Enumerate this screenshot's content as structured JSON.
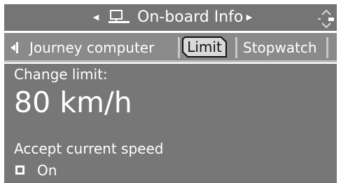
{
  "header": {
    "title": "On-board Info",
    "icons": {
      "left": "arrow-left-small-icon",
      "computer": "computer-icon",
      "right": "arrow-right-small-icon",
      "updown": "up-down-selector-icon"
    }
  },
  "tabs": {
    "back_icon": "back-arrow-icon",
    "journey_computer": "Journey computer",
    "limit": "Limit",
    "stopwatch": "Stopwatch",
    "selected": "Limit"
  },
  "content": {
    "change_limit_label": "Change limit:",
    "limit_value": "80 km/h",
    "accept_current_speed": "Accept current speed",
    "option_label": "On"
  },
  "colors": {
    "header_bg": "#757575",
    "tabbar_bg": "#8a8a8a",
    "content_bg": "#777777",
    "text": "#ffffff",
    "selected_tab_fill": "#d9d9d9"
  }
}
